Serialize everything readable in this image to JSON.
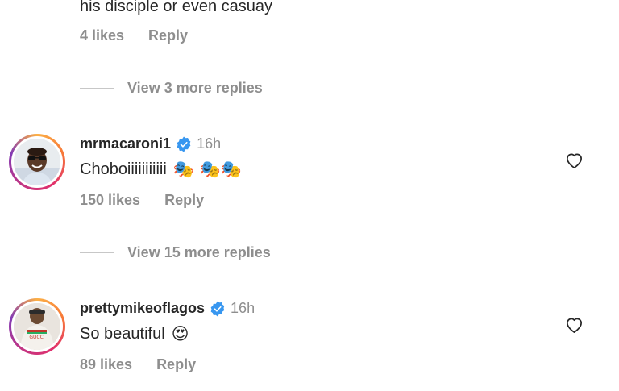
{
  "top_comment": {
    "text_fragment": "his disciple or even casuay",
    "likes": "4 likes",
    "reply": "Reply"
  },
  "view_more_1": "View 3 more replies",
  "comments": [
    {
      "username": "mrmacaroni1",
      "time": "16h",
      "text": "Choboiiiiiiiiiii",
      "emoji": "🎭 🎭🎭",
      "likes": "150 likes",
      "reply": "Reply"
    },
    {
      "username": "prettymikeoflagos",
      "time": "16h",
      "text": "So beautiful",
      "emoji": "😍",
      "likes": "89 likes",
      "reply": "Reply"
    }
  ],
  "view_more_2": "View 15 more replies",
  "colors": {
    "verified": "#3897f0",
    "secondary_text": "#8e8e8e",
    "primary_text": "#262626"
  }
}
